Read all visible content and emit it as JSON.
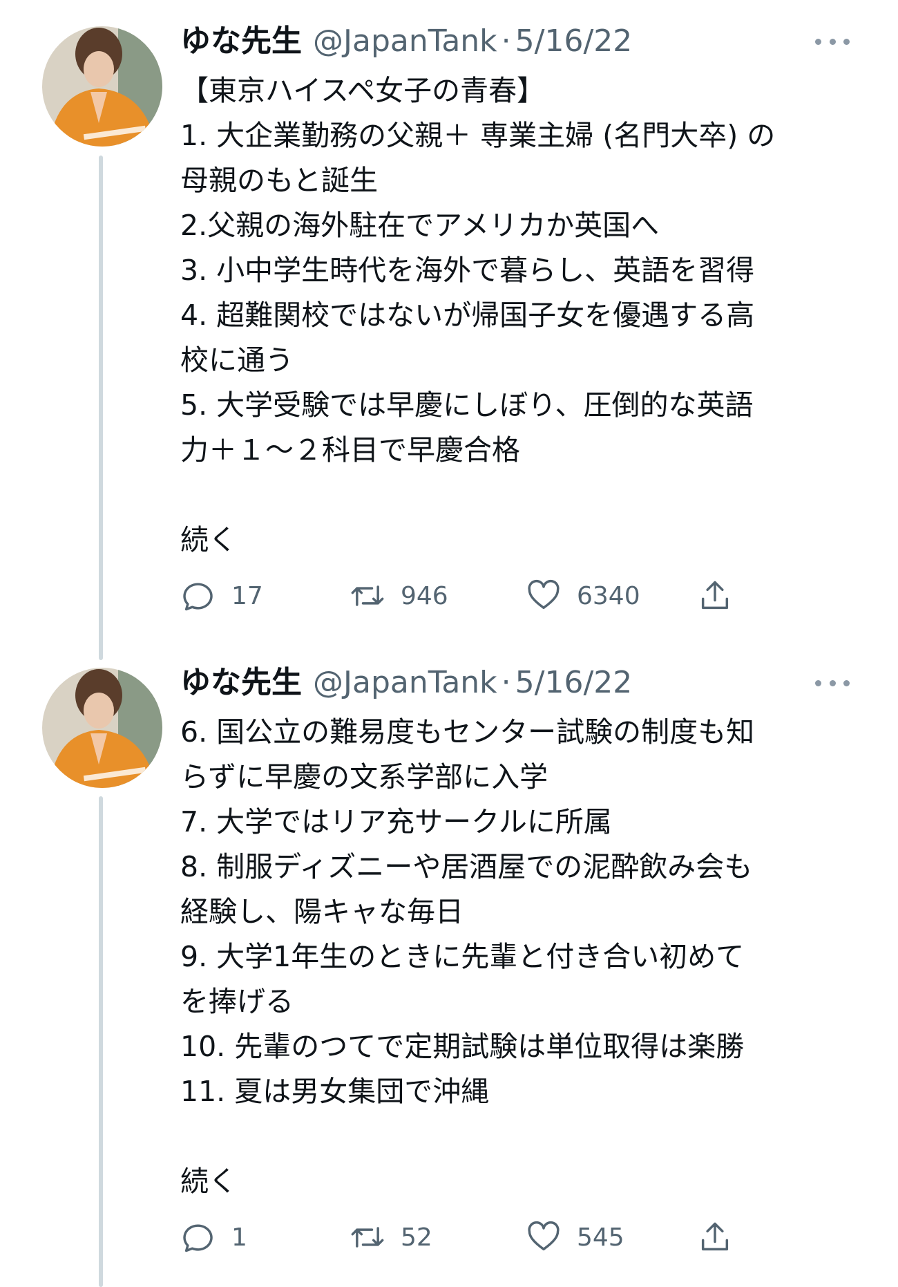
{
  "tweets": [
    {
      "author_name": "ゆな先生",
      "handle": "@JapanTank",
      "separator": "·",
      "date": "5/16/22",
      "lines": [
        "【東京ハイスペ女子の青春】",
        "1. 大企業勤務の父親＋ 専業主婦 (名門大卒) の",
        "母親のもと誕生",
        "2.父親の海外駐在でアメリカか英国へ",
        "3. 小中学生時代を海外で暮らし、英語を習得",
        "4. 超難関校ではないが帰国子女を優遇する高",
        "校に通う",
        "5. 大学受験では早慶にしぼり、圧倒的な英語",
        "力＋１～２科目で早慶合格"
      ],
      "continued": "続く",
      "replies": "17",
      "retweets": "946",
      "likes": "6340",
      "icons": {
        "reply": "reply-icon",
        "retweet": "retweet-icon",
        "like": "heart-icon",
        "share": "share-icon",
        "more": "more-icon"
      }
    },
    {
      "author_name": "ゆな先生",
      "handle": "@JapanTank",
      "separator": "·",
      "date": "5/16/22",
      "lines": [
        "6. 国公立の難易度もセンター試験の制度も知",
        "らずに早慶の文系学部に入学",
        "7. 大学ではリア充サークルに所属",
        "8. 制服ディズニーや居酒屋での泥酔飲み会も",
        "経験し、陽キャな毎日",
        "9. 大学1年生のときに先輩と付き合い初めて",
        "を捧げる",
        "10. 先輩のつてで定期試験は単位取得は楽勝",
        "11. 夏は男女集団で沖縄"
      ],
      "continued": "続く",
      "replies": "1",
      "retweets": "52",
      "likes": "545",
      "icons": {
        "reply": "reply-icon",
        "retweet": "retweet-icon",
        "like": "heart-icon",
        "share": "share-icon",
        "more": "more-icon"
      }
    }
  ],
  "colors": {
    "text": "#0f1419",
    "secondary": "#536471",
    "thread_line": "#cfd9de",
    "avatar_sweater": "#e8902a"
  }
}
